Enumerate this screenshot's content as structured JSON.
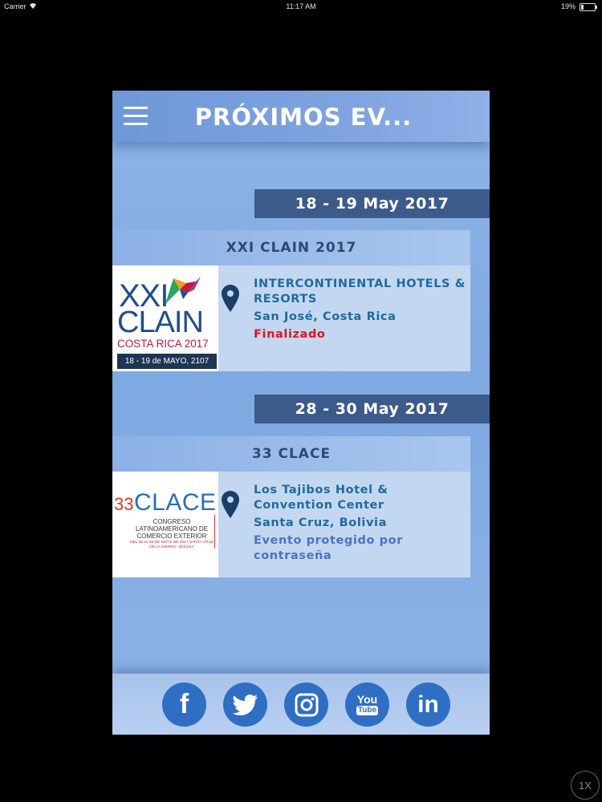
{
  "status_bar": {
    "carrier": "Carrier",
    "time": "11:17 AM",
    "battery_percent": "19%",
    "battery_level": 0.19
  },
  "header": {
    "title": "PRÓXIMOS EV...",
    "menu_icon": "hamburger-menu-icon"
  },
  "events": [
    {
      "date_range": "18 - 19 May 2017",
      "name": "XXI CLAIN 2017",
      "venue": "INTERCONTINENTAL HOTELS & RESORTS",
      "city": "San José, Costa Rica",
      "status": "Finalizado",
      "status_color": "#e3141e",
      "logo": {
        "line1": "XXI",
        "line2": "CLAIN",
        "line3": "COSTA RICA 2017",
        "dates": "18 - 19 de MAYO, 2107"
      }
    },
    {
      "date_range": "28 - 30 May 2017",
      "name": "33 CLACE",
      "venue": "Los Tajibos Hotel & Convention Center",
      "city": "Santa Cruz, Bolivia",
      "status": "Evento protegido por contraseña",
      "status_color": "#4a72c6",
      "logo": {
        "number": "33",
        "word": "CLACE",
        "subtitle": "CONGRESO LATINOAMERICANO DE COMERCIO EXTERIOR",
        "detail": "DEL 28 AL 30 DE MAYO DE 2017 SANTA CRUZ DE LA SIERRA - BOLIVIA"
      }
    }
  ],
  "footer": {
    "social": [
      {
        "icon": "facebook-icon",
        "glyph": "f"
      },
      {
        "icon": "twitter-icon",
        "glyph": ""
      },
      {
        "icon": "instagram-icon",
        "glyph": ""
      },
      {
        "icon": "youtube-icon",
        "glyph_top": "You",
        "glyph_bottom": "Tube"
      },
      {
        "icon": "linkedin-icon",
        "glyph": "in"
      }
    ]
  },
  "zoom_button": "1X",
  "colors": {
    "date_banner": "#3c5a8a",
    "social_blue": "#2e6fc4",
    "venue_text": "#1f6aa0"
  }
}
